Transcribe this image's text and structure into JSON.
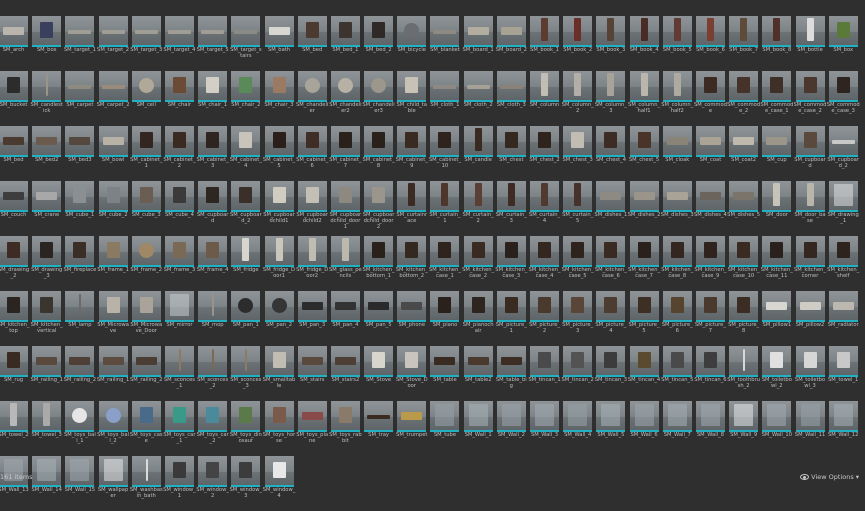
{
  "status_bar": {
    "item_count": "161 items",
    "view_options": "View Options",
    "view_options_arrow": "▾"
  },
  "assets": [
    {
      "label": "SM_arch",
      "shape": "wide",
      "color": "#b9b5ac"
    },
    {
      "label": "SM_box",
      "shape": "box",
      "color": "#3a3f5e"
    },
    {
      "label": "SM_target_1",
      "shape": "flat",
      "color": "#a09d95"
    },
    {
      "label": "SM_target_2",
      "shape": "flat",
      "color": "#a09d95"
    },
    {
      "label": "SM_target_3",
      "shape": "flat",
      "color": "#a09d95"
    },
    {
      "label": "SM_target_4",
      "shape": "flat",
      "color": "#a09d95"
    },
    {
      "label": "SM_target_5",
      "shape": "flat",
      "color": "#a09d95"
    },
    {
      "label": "SM_target_stairs",
      "shape": "flat",
      "color": "#8b8b86"
    },
    {
      "label": "SM_bath",
      "shape": "wide",
      "color": "#d8d6d0"
    },
    {
      "label": "SM_bed",
      "shape": "box",
      "color": "#4a3a30"
    },
    {
      "label": "SM_bed_1",
      "shape": "box",
      "color": "#3d3430"
    },
    {
      "label": "SM_bed_2",
      "shape": "box",
      "color": "#2f2a28"
    },
    {
      "label": "SM_bicycle",
      "shape": "round",
      "color": "#6a6e72"
    },
    {
      "label": "SM_blanket",
      "shape": "flat",
      "color": "#8e8a82"
    },
    {
      "label": "SM_board_1",
      "shape": "wide",
      "color": "#b3ada0"
    },
    {
      "label": "SM_board_2",
      "shape": "wide",
      "color": "#a8a295"
    },
    {
      "label": "SM_book_1",
      "shape": "tall",
      "color": "#5c3b30"
    },
    {
      "label": "SM_book_2",
      "shape": "tall",
      "color": "#6b2f2a"
    },
    {
      "label": "SM_book_3",
      "shape": "tall",
      "color": "#574336"
    },
    {
      "label": "SM_book_4",
      "shape": "tall",
      "color": "#4a2c26"
    },
    {
      "label": "SM_book_5",
      "shape": "tall",
      "color": "#603a33"
    },
    {
      "label": "SM_book_6",
      "shape": "tall",
      "color": "#7a3f33"
    },
    {
      "label": "SM_book_7",
      "shape": "tall",
      "color": "#5e4b3a"
    },
    {
      "label": "SM_book_8",
      "shape": "tall",
      "color": "#4f3128"
    },
    {
      "label": "SM_bottle",
      "shape": "tall",
      "color": "#dcdcdc"
    },
    {
      "label": "SM_box",
      "shape": "box",
      "color": "#5a7a3a"
    },
    {
      "label": "SM_bucket",
      "shape": "box",
      "color": "#2c2c2c"
    },
    {
      "label": "SM_candlestick",
      "shape": "thin",
      "color": "#9a948a"
    },
    {
      "label": "SM_carpet",
      "shape": "flat",
      "color": "#8f8a80"
    },
    {
      "label": "SM_carpet_2",
      "shape": "flat",
      "color": "#9a8c7a"
    },
    {
      "label": "SM_ceil",
      "shape": "round",
      "color": "#b0a898"
    },
    {
      "label": "SM_chair",
      "shape": "box",
      "color": "#6b4b36"
    },
    {
      "label": "SM_chair_1",
      "shape": "box",
      "color": "#d3cfc7"
    },
    {
      "label": "SM_chair_2",
      "shape": "box",
      "color": "#5b8a5a"
    },
    {
      "label": "SM_chair_3",
      "shape": "box",
      "color": "#9a7a62"
    },
    {
      "label": "SM_chandelier",
      "shape": "round",
      "color": "#a9a49a"
    },
    {
      "label": "SM_chandelier2",
      "shape": "round",
      "color": "#b6b0a5"
    },
    {
      "label": "SM_chandelier3",
      "shape": "round",
      "color": "#9c978d"
    },
    {
      "label": "SM_child_table",
      "shape": "box",
      "color": "#c7c1b6"
    },
    {
      "label": "SM_cloth_1",
      "shape": "flat",
      "color": "#8d8982"
    },
    {
      "label": "SM_cloth_2",
      "shape": "flat",
      "color": "#a6a097"
    },
    {
      "label": "SM_cloth_3",
      "shape": "flat",
      "color": "#8a8279"
    },
    {
      "label": "SM_column",
      "shape": "tall",
      "color": "#c1bdb4"
    },
    {
      "label": "SM_column_2",
      "shape": "tall",
      "color": "#b4afa6"
    },
    {
      "label": "SM_column_3",
      "shape": "tall",
      "color": "#a8a399"
    },
    {
      "label": "SM_column_half1",
      "shape": "tall",
      "color": "#bbb6ad"
    },
    {
      "label": "SM_column_half2",
      "shape": "tall",
      "color": "#afaaa1"
    },
    {
      "label": "SM_commode",
      "shape": "box",
      "color": "#3b2b23"
    },
    {
      "label": "SM_commode_2",
      "shape": "box",
      "color": "#45332a"
    },
    {
      "label": "SM_commode_case_1",
      "shape": "box",
      "color": "#3e2f27"
    },
    {
      "label": "SM_commode_case_2",
      "shape": "box",
      "color": "#4a372d"
    },
    {
      "label": "SM_commode_case_3",
      "shape": "box",
      "color": "#2f2520"
    },
    {
      "label": "SM_bed",
      "shape": "wide",
      "color": "#4a3a30"
    },
    {
      "label": "SM_bed2",
      "shape": "wide",
      "color": "#6b5a4e"
    },
    {
      "label": "SM_bed3",
      "shape": "wide",
      "color": "#54483f"
    },
    {
      "label": "SM_bowl",
      "shape": "wide",
      "color": "#b8b2a6"
    },
    {
      "label": "SM_cabinet_1",
      "shape": "box",
      "color": "#332620"
    },
    {
      "label": "SM_cabinet_2",
      "shape": "box",
      "color": "#3a2a22"
    },
    {
      "label": "SM_cabinet_3",
      "shape": "box",
      "color": "#2e2420"
    },
    {
      "label": "SM_cabinet_4",
      "shape": "box",
      "color": "#c9c4ba"
    },
    {
      "label": "SM_cabinet_5",
      "shape": "box",
      "color": "#2a1f1a"
    },
    {
      "label": "SM_cabinet_6",
      "shape": "box",
      "color": "#3f2e25"
    },
    {
      "label": "SM_cabinet_7",
      "shape": "box",
      "color": "#2b211c"
    },
    {
      "label": "SM_cabinet_8",
      "shape": "box",
      "color": "#2b211c"
    },
    {
      "label": "SM_cabinet_9",
      "shape": "box",
      "color": "#3a2b22"
    },
    {
      "label": "SM_cabinet_10",
      "shape": "box",
      "color": "#2f231d"
    },
    {
      "label": "SM_candle",
      "shape": "tall",
      "color": "#3a2b22"
    },
    {
      "label": "SM_chest",
      "shape": "box",
      "color": "#352820"
    },
    {
      "label": "SM_chest_2",
      "shape": "box",
      "color": "#2f241d"
    },
    {
      "label": "SM_chest_3",
      "shape": "box",
      "color": "#c2bdb3"
    },
    {
      "label": "SM_chest_4",
      "shape": "box",
      "color": "#3c2c24"
    },
    {
      "label": "SM_chest_5",
      "shape": "box",
      "color": "#4a3329"
    },
    {
      "label": "SM_cloak",
      "shape": "wide",
      "color": "#8a8377"
    },
    {
      "label": "SM_coat",
      "shape": "wide",
      "color": "#aaa396"
    },
    {
      "label": "SM_coat2",
      "shape": "wide",
      "color": "#bfb8ac"
    },
    {
      "label": "SM_cup",
      "shape": "wide",
      "color": "#9c958a"
    },
    {
      "label": "SM_cupboard",
      "shape": "box",
      "color": "#5a4a3e"
    },
    {
      "label": "SM_cupboard_2",
      "shape": "flat",
      "color": "#c8c8c8"
    },
    {
      "label": "SM_couch",
      "shape": "wide",
      "color": "#3d3d3d"
    },
    {
      "label": "SM_crane",
      "shape": "wide",
      "color": "#a8a8a8"
    },
    {
      "label": "SM_cube_1",
      "shape": "box",
      "color": "#8a8f92"
    },
    {
      "label": "SM_cube_2",
      "shape": "box",
      "color": "#7c8286"
    },
    {
      "label": "SM_cube_3",
      "shape": "box",
      "color": "#6a5d52"
    },
    {
      "label": "SM_cube_4",
      "shape": "box",
      "color": "#3a3a3a"
    },
    {
      "label": "SM_cupboard",
      "shape": "box",
      "color": "#2e2620"
    },
    {
      "label": "SM_cupboard_2",
      "shape": "box",
      "color": "#3b3029"
    },
    {
      "label": "SM_cupboardchild1",
      "shape": "box",
      "color": "#d1ccc2"
    },
    {
      "label": "SM_cupboardchild2",
      "shape": "box",
      "color": "#c4bfb5"
    },
    {
      "label": "SM_cupboardchild_door1",
      "shape": "box",
      "color": "#8e8980"
    },
    {
      "label": "SM_cupboardchild_door2",
      "shape": "box",
      "color": "#9b968c"
    },
    {
      "label": "SM_curtainrace",
      "shape": "tall",
      "color": "#3b2b22"
    },
    {
      "label": "SM_curtain_1",
      "shape": "tall",
      "color": "#4d362c"
    },
    {
      "label": "SM_curtain_2",
      "shape": "tall",
      "color": "#5a4034"
    },
    {
      "label": "SM_curtain_3",
      "shape": "tall",
      "color": "#3e2c24"
    },
    {
      "label": "SM_curtain_4",
      "shape": "tall",
      "color": "#50392f"
    },
    {
      "label": "SM_curtain_5",
      "shape": "tall",
      "color": "#45322a"
    },
    {
      "label": "SM_dishes_1",
      "shape": "wide",
      "color": "#8c8a82"
    },
    {
      "label": "SM_dishes_2",
      "shape": "wide",
      "color": "#9a948a"
    },
    {
      "label": "SM_dishes_3",
      "shape": "wide",
      "color": "#a8a297"
    },
    {
      "label": "SM_dishes_4",
      "shape": "wide",
      "color": "#6a645c"
    },
    {
      "label": "SM_dishes_5",
      "shape": "wide",
      "color": "#7a746a"
    },
    {
      "label": "SM_door",
      "shape": "tall",
      "color": "#c8c3b9"
    },
    {
      "label": "SM_door_base",
      "shape": "tall",
      "color": "#bab5ab"
    },
    {
      "label": "SM_drawing_1",
      "shape": "pane",
      "color": "#e0e0e0"
    },
    {
      "label": "SM_drawing_2",
      "shape": "box",
      "color": "#3e2c24"
    },
    {
      "label": "SM_drawing_3",
      "shape": "box",
      "color": "#2a2520"
    },
    {
      "label": "SM_fireplace",
      "shape": "box",
      "color": "#3a2e26"
    },
    {
      "label": "SM_frame_1",
      "shape": "box",
      "color": "#8a7a62"
    },
    {
      "label": "SM_frame_2",
      "shape": "round",
      "color": "#a08866"
    },
    {
      "label": "SM_frame_3",
      "shape": "box",
      "color": "#7a6a55"
    },
    {
      "label": "SM_frame_4",
      "shape": "box",
      "color": "#6b5b48"
    },
    {
      "label": "SM_fridge",
      "shape": "tall",
      "color": "#d8d5cf"
    },
    {
      "label": "SM_fridge_Door1",
      "shape": "tall",
      "color": "#cac6be"
    },
    {
      "label": "SM_fridge_Door2",
      "shape": "tall",
      "color": "#c0bcb4"
    },
    {
      "label": "SM_glass_pencils",
      "shape": "tall",
      "color": "#bdb8ae"
    },
    {
      "label": "SM_kitchen_bottom_1",
      "shape": "box",
      "color": "#2b211c"
    },
    {
      "label": "SM_kitchen_bottom_2",
      "shape": "box",
      "color": "#34281f"
    },
    {
      "label": "SM_kitchen_case_1",
      "shape": "box",
      "color": "#2f241d"
    },
    {
      "label": "SM_kitchen_case_2",
      "shape": "box",
      "color": "#3a2b22"
    },
    {
      "label": "SM_kitchen_case_3",
      "shape": "box",
      "color": "#2b211c"
    },
    {
      "label": "SM_kitchen_case_4",
      "shape": "box",
      "color": "#33271f"
    },
    {
      "label": "SM_kitchen_case_5",
      "shape": "box",
      "color": "#2f241d"
    },
    {
      "label": "SM_kitchen_case_6",
      "shape": "box",
      "color": "#3a2b22"
    },
    {
      "label": "SM_kitchen_case_7",
      "shape": "box",
      "color": "#2b211c"
    },
    {
      "label": "SM_kitchen_case_8",
      "shape": "box",
      "color": "#33271f"
    },
    {
      "label": "SM_kitchen_case_9",
      "shape": "box",
      "color": "#2f241d"
    },
    {
      "label": "SM_kitchen_case_10",
      "shape": "box",
      "color": "#3a2b22"
    },
    {
      "label": "SM_kitchen_case_11",
      "shape": "box",
      "color": "#2b211c"
    },
    {
      "label": "SM_kitchen_corner",
      "shape": "box",
      "color": "#33271f"
    },
    {
      "label": "SM_kitchen_shelf",
      "shape": "box",
      "color": "#2f241d"
    },
    {
      "label": "SM_kitchen_top",
      "shape": "box",
      "color": "#2a2520"
    },
    {
      "label": "SM_kitchen_vertical",
      "shape": "box",
      "color": "#3b3530"
    },
    {
      "label": "SM_lamp",
      "shape": "thin",
      "color": "#6a6a6a"
    },
    {
      "label": "SM_Microwave",
      "shape": "box",
      "color": "#b8b2a8"
    },
    {
      "label": "SM_Microwave_Door",
      "shape": "box",
      "color": "#a9a399"
    },
    {
      "label": "SM_mirror",
      "shape": "pane",
      "color": "#c8ccd0"
    },
    {
      "label": "SM_mop",
      "shape": "thin",
      "color": "#9a948a"
    },
    {
      "label": "SM_pan_1",
      "shape": "round",
      "color": "#2c2c2c"
    },
    {
      "label": "SM_pan_2",
      "shape": "round",
      "color": "#353535"
    },
    {
      "label": "SM_pan_3",
      "shape": "wide",
      "color": "#2c2c2c"
    },
    {
      "label": "SM_pan_4",
      "shape": "wide",
      "color": "#333333"
    },
    {
      "label": "SM_pan_5",
      "shape": "wide",
      "color": "#2a2a2a"
    },
    {
      "label": "SM_phone",
      "shape": "wide",
      "color": "#4a4a4a"
    },
    {
      "label": "SM_piano",
      "shape": "box",
      "color": "#2a211c"
    },
    {
      "label": "SM_pianochair",
      "shape": "box",
      "color": "#2e2520"
    },
    {
      "label": "SM_picture_1",
      "shape": "box",
      "color": "#3a2b22"
    },
    {
      "label": "SM_picture_2",
      "shape": "box",
      "color": "#4a3a2e"
    },
    {
      "label": "SM_picture_3",
      "shape": "box",
      "color": "#5a4638"
    },
    {
      "label": "SM_picture_4",
      "shape": "box",
      "color": "#4d3c30"
    },
    {
      "label": "SM_picture_5",
      "shape": "box",
      "color": "#3e2f25"
    },
    {
      "label": "SM_picture_6",
      "shape": "box",
      "color": "#57442f"
    },
    {
      "label": "SM_picture_7",
      "shape": "box",
      "color": "#4a3a2e"
    },
    {
      "label": "SM_picture_8",
      "shape": "box",
      "color": "#3c2d24"
    },
    {
      "label": "SM_pillow1",
      "shape": "wide",
      "color": "#d8d6d0"
    },
    {
      "label": "SM_pillow2",
      "shape": "wide",
      "color": "#cfccc5"
    },
    {
      "label": "SM_radiator",
      "shape": "wide",
      "color": "#bcb8b0"
    },
    {
      "label": "SM_rug",
      "shape": "box",
      "color": "#3a2b22"
    },
    {
      "label": "SM_railing_1",
      "shape": "wide",
      "color": "#5a4a3e"
    },
    {
      "label": "SM_railing_2",
      "shape": "wide",
      "color": "#4e4036"
    },
    {
      "label": "SM_railing_1",
      "shape": "wide",
      "color": "#5c4c40"
    },
    {
      "label": "SM_railing_2",
      "shape": "wide",
      "color": "#4a3d33"
    },
    {
      "label": "SM_sconces_1",
      "shape": "thin",
      "color": "#8a7a62"
    },
    {
      "label": "SM_sconces_2",
      "shape": "thin",
      "color": "#7a6a55"
    },
    {
      "label": "SM_sconces_3",
      "shape": "thin",
      "color": "#8c7c66"
    },
    {
      "label": "SM_smalltable",
      "shape": "box",
      "color": "#c2bdb3"
    },
    {
      "label": "SM_stairs",
      "shape": "wide",
      "color": "#5a4a3e"
    },
    {
      "label": "SM_stairs2",
      "shape": "wide",
      "color": "#4d3f35"
    },
    {
      "label": "SM_Stove",
      "shape": "box",
      "color": "#d8d5cf"
    },
    {
      "label": "SM_Stove_Door",
      "shape": "box",
      "color": "#c9c5be"
    },
    {
      "label": "SM_table",
      "shape": "wide",
      "color": "#3a2b22"
    },
    {
      "label": "SM_table2",
      "shape": "wide",
      "color": "#4a3a2e"
    },
    {
      "label": "SM_table_big",
      "shape": "wide",
      "color": "#3d2e25"
    },
    {
      "label": "SM_tincan_1",
      "shape": "box",
      "color": "#4a4a4a"
    },
    {
      "label": "SM_tincan_2",
      "shape": "box",
      "color": "#535353"
    },
    {
      "label": "SM_tincan_3",
      "shape": "box",
      "color": "#3c3c3c"
    },
    {
      "label": "SM_tincan_4",
      "shape": "box",
      "color": "#5a4a2e"
    },
    {
      "label": "SM_tincan_5",
      "shape": "box",
      "color": "#4a4a4a"
    },
    {
      "label": "SM_tincan_6",
      "shape": "box",
      "color": "#3d3d3d"
    },
    {
      "label": "SM_toothbrush_2",
      "shape": "thin",
      "color": "#d8d8d8"
    },
    {
      "label": "SM_toiletbowl_2",
      "shape": "box",
      "color": "#e0e0e0"
    },
    {
      "label": "SM_toiletbowl_3",
      "shape": "box",
      "color": "#d6d6d6"
    },
    {
      "label": "SM_towel_1",
      "shape": "box",
      "color": "#c8c8c8"
    },
    {
      "label": "SM_towel_2",
      "shape": "tall",
      "color": "#b8b8b8"
    },
    {
      "label": "SM_towel_3",
      "shape": "tall",
      "color": "#aaaaaa"
    },
    {
      "label": "SM_toys_ball_1",
      "shape": "round",
      "color": "#e6e6e6"
    },
    {
      "label": "SM_toys_ball_2",
      "shape": "round",
      "color": "#8aa0c8"
    },
    {
      "label": "SM_toys_case",
      "shape": "box",
      "color": "#4a6a8a"
    },
    {
      "label": "SM_toys_car_1",
      "shape": "box",
      "color": "#3a9a8a"
    },
    {
      "label": "SM_toys_car_2",
      "shape": "box",
      "color": "#4a8a9a"
    },
    {
      "label": "SM_toys_dinosaur",
      "shape": "box",
      "color": "#5a7a4a"
    },
    {
      "label": "SM_toys_horse",
      "shape": "box",
      "color": "#7a5a4a"
    },
    {
      "label": "SM_toys_plane",
      "shape": "wide",
      "color": "#8a4a4a"
    },
    {
      "label": "SM_toys_rabbit",
      "shape": "box",
      "color": "#8a7a6a"
    },
    {
      "label": "SM_tray",
      "shape": "flat",
      "color": "#3a2b22"
    },
    {
      "label": "SM_trumpet",
      "shape": "wide",
      "color": "#b89a4a"
    },
    {
      "label": "SM_tube",
      "shape": "pane",
      "color": "#98a2a8"
    },
    {
      "label": "SM_Wall_1",
      "shape": "pane",
      "color": "#a8b2b8"
    },
    {
      "label": "SM_Wall_2",
      "shape": "pane",
      "color": "#9aa4aa"
    },
    {
      "label": "SM_Wall_3",
      "shape": "pane",
      "color": "#a2acb2"
    },
    {
      "label": "SM_Wall_4",
      "shape": "pane",
      "color": "#98a2a8"
    },
    {
      "label": "SM_Wall_5",
      "shape": "pane",
      "color": "#a8b2b8"
    },
    {
      "label": "SM_Wall_6",
      "shape": "pane",
      "color": "#9ca6ac"
    },
    {
      "label": "SM_Wall_7",
      "shape": "pane",
      "color": "#a4aeb4"
    },
    {
      "label": "SM_Wall_8",
      "shape": "pane",
      "color": "#a0aab0"
    },
    {
      "label": "SM_Wall_9",
      "shape": "pane",
      "color": "#e8e8e8"
    },
    {
      "label": "SM_Wall_10",
      "shape": "pane",
      "color": "#a2acb2"
    },
    {
      "label": "SM_Wall_11",
      "shape": "pane",
      "color": "#98a2a8"
    },
    {
      "label": "SM_Wall_12",
      "shape": "pane",
      "color": "#a6b0b6"
    },
    {
      "label": "SM_Wall_13",
      "shape": "pane",
      "color": "#9ea8ae"
    },
    {
      "label": "SM_Wall_14",
      "shape": "pane",
      "color": "#a8b2b8"
    },
    {
      "label": "SM_Wall_15",
      "shape": "pane",
      "color": "#a0aab0"
    },
    {
      "label": "SM_wallpaper",
      "shape": "pane",
      "color": "#e8e8e8"
    },
    {
      "label": "SM_washbasin_bath",
      "shape": "thin",
      "color": "#dcdcdc"
    },
    {
      "label": "SM_window_1",
      "shape": "box",
      "color": "#3a3a3a"
    },
    {
      "label": "SM_window_2",
      "shape": "box",
      "color": "#444444"
    },
    {
      "label": "SM_window_3",
      "shape": "box",
      "color": "#3c3c3c"
    },
    {
      "label": "SM_window_4",
      "shape": "box",
      "color": "#e8e8e8"
    }
  ]
}
